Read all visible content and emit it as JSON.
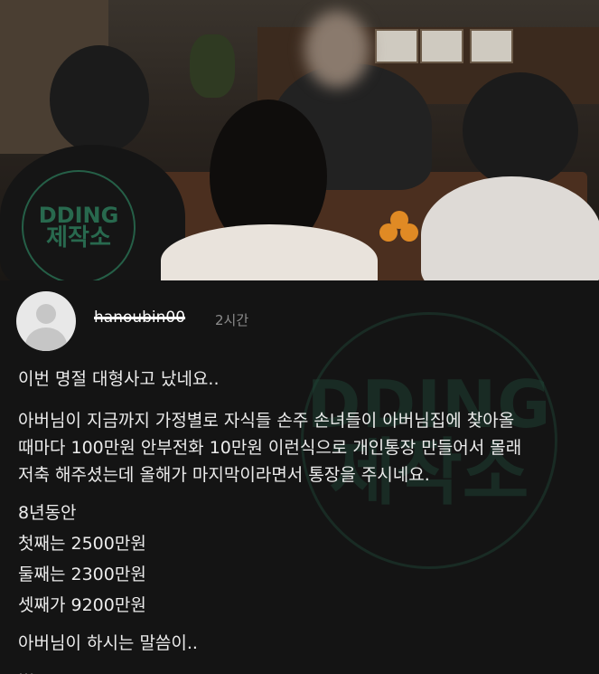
{
  "image": {
    "watermark_line1": "DDING",
    "watermark_line2": "제작소"
  },
  "post": {
    "username": "hanoubin00",
    "time": "2시간",
    "lines": [
      "이번 명절 대형사고 났네요..",
      "아버님이 지금까지 가정별로 자식들 손주 손녀들이 아버님집에 찾아올",
      "때마다 100만원 안부전화 10만원 이런식으로 개인통장 만들어서 몰래",
      "저축 해주셨는데 올해가 마지막이라면서 통장을 주시네요.",
      "8년동안",
      "첫째는 2500만원",
      "둘째는 2300만원",
      "셋째가 9200만원",
      "아버님이 하시는 말씀이..",
      "..."
    ]
  }
}
